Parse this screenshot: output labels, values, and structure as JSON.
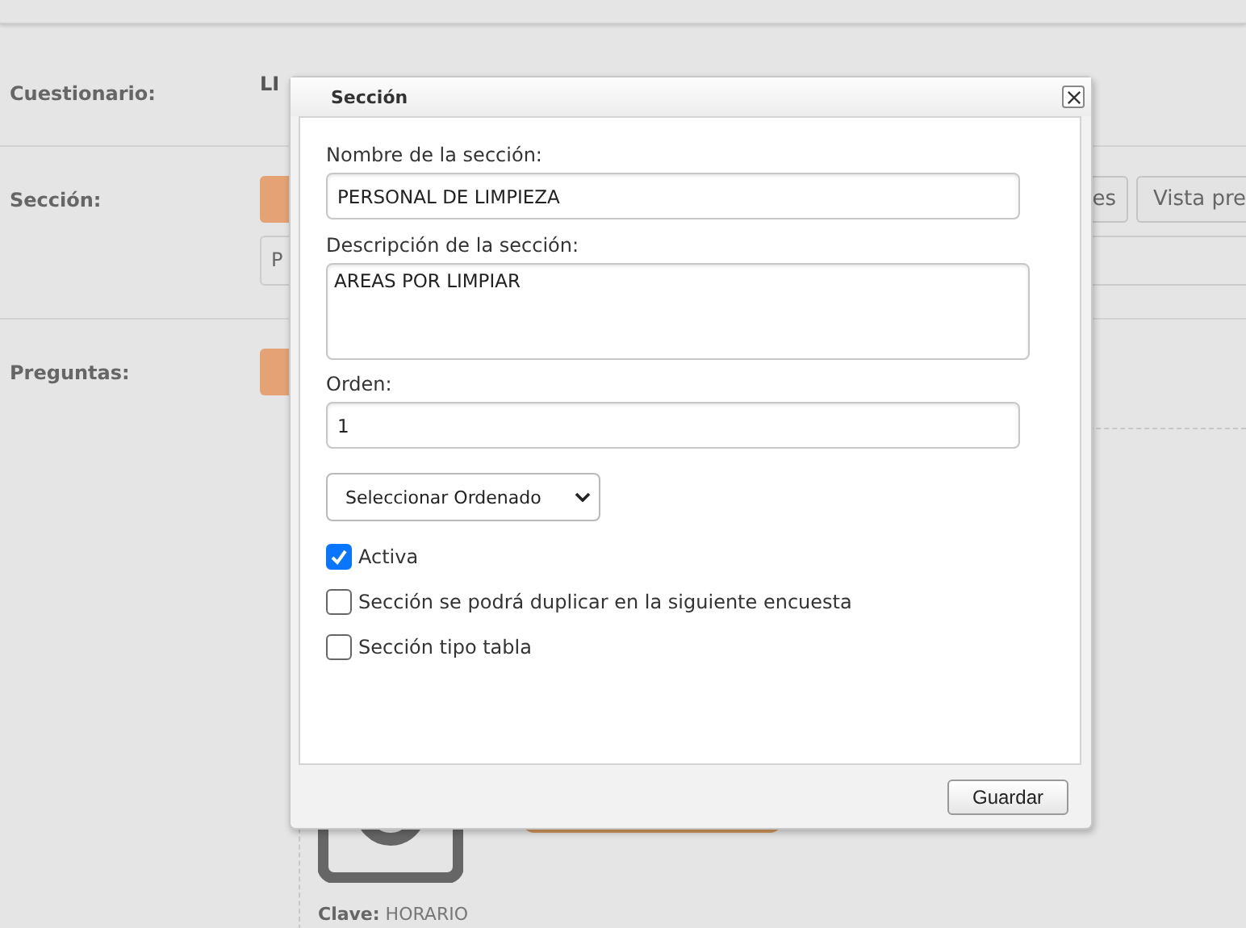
{
  "page": {
    "rows": [
      {
        "label": "Cuestionario:",
        "value": "LI"
      },
      {
        "label": "Sección:"
      },
      {
        "label": "Preguntas:"
      }
    ],
    "section_buttons": [
      "es",
      "Vista pre"
    ],
    "section_field": {
      "value": "P"
    },
    "question": {
      "key_label": "Clave:",
      "key_value": "HORARIO"
    }
  },
  "dialog": {
    "title": "Sección",
    "fields": [
      {
        "kind": "input",
        "label": "Nombre de la sección:",
        "value": "PERSONAL DE LIMPIEZA"
      },
      {
        "kind": "textarea",
        "label": "Descripción de la sección:",
        "value": "AREAS POR LIMPIAR"
      },
      {
        "kind": "input",
        "label": "Orden:",
        "value": "1"
      }
    ],
    "select": {
      "value": "Seleccionar Ordenado"
    },
    "checkboxes": [
      {
        "label": "Activa",
        "checked": true
      },
      {
        "label": "Sección se podrá duplicar en la siguiente encuesta",
        "checked": false
      },
      {
        "label": "Sección tipo tabla",
        "checked": false
      }
    ],
    "buttons": [
      "Guardar"
    ]
  }
}
